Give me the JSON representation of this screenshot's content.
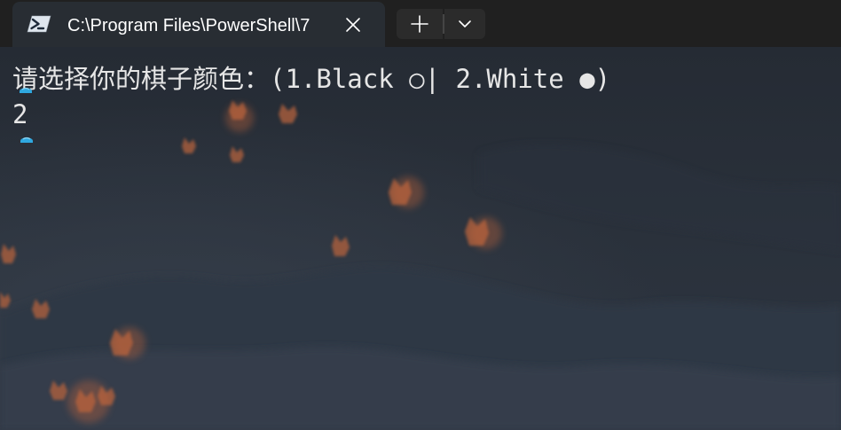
{
  "tab": {
    "title": "C:\\Program Files\\PowerShell\\7",
    "icon": "powershell-icon",
    "close_icon": "close-icon"
  },
  "toolbar": {
    "new_tab_icon": "plus-icon",
    "dropdown_icon": "chevron-down-icon"
  },
  "terminal": {
    "prompt_line": "请选择你的棋子颜色：(1.Black ○| 2.White ●)",
    "input_line": "2",
    "marker_icon": "shell-integration-mark-icon"
  },
  "colors": {
    "tabbar_bg": "#202020",
    "active_tab_bg": "#282d33",
    "terminal_text": "#e6e6e6",
    "marker": "#2fa8e0",
    "background_ember": "#c8663a"
  }
}
